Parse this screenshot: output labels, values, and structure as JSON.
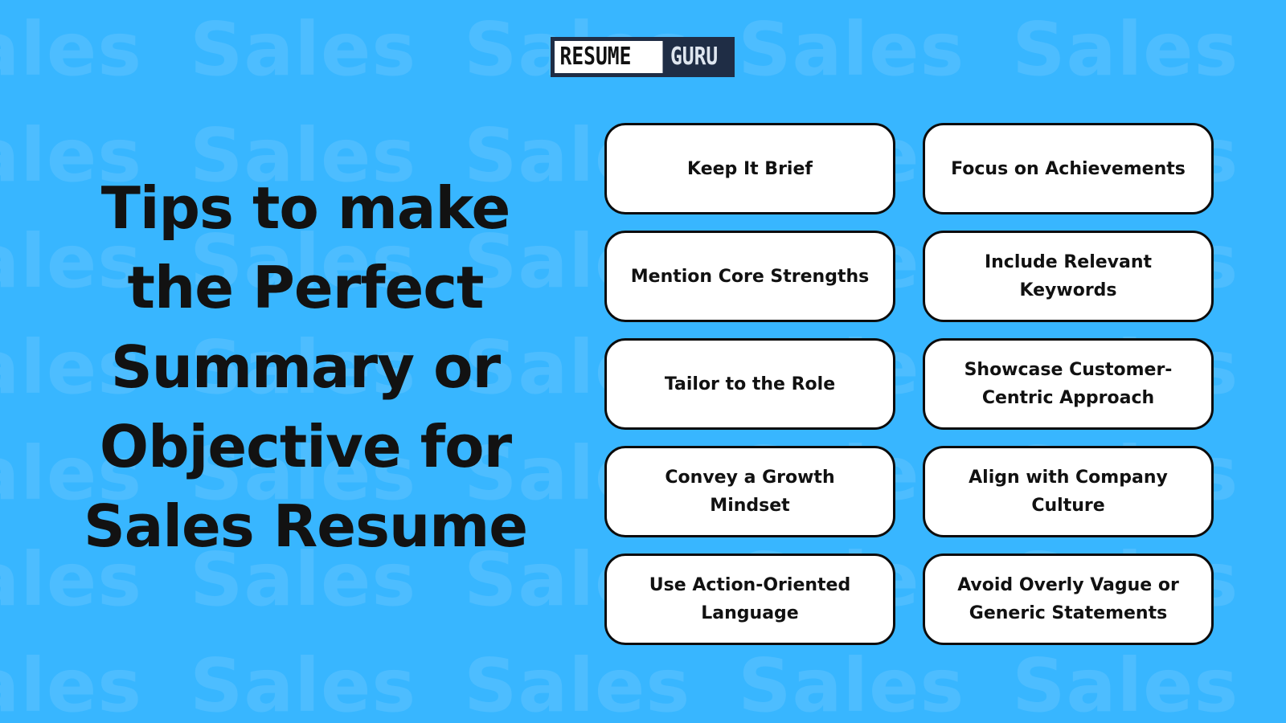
{
  "background": {
    "color": "#38b6ff",
    "watermark_word": "Sales",
    "watermark_color": "#4dbdff"
  },
  "logo": {
    "part1": "RESUME",
    "part2": "GURU"
  },
  "title": "Tips to make the Perfect Summary or Objective for Sales Resume",
  "tips": [
    {
      "label": "Keep It Brief"
    },
    {
      "label": "Focus on Achievements"
    },
    {
      "label": "Mention Core Strengths"
    },
    {
      "label": "Include Relevant Keywords"
    },
    {
      "label": "Tailor to the Role"
    },
    {
      "label": "Showcase Customer-Centric Approach"
    },
    {
      "label": "Convey a Growth Mindset"
    },
    {
      "label": "Align with Company Culture"
    },
    {
      "label": "Use Action-Oriented Language"
    },
    {
      "label": "Avoid Overly Vague or Generic Statements"
    }
  ]
}
